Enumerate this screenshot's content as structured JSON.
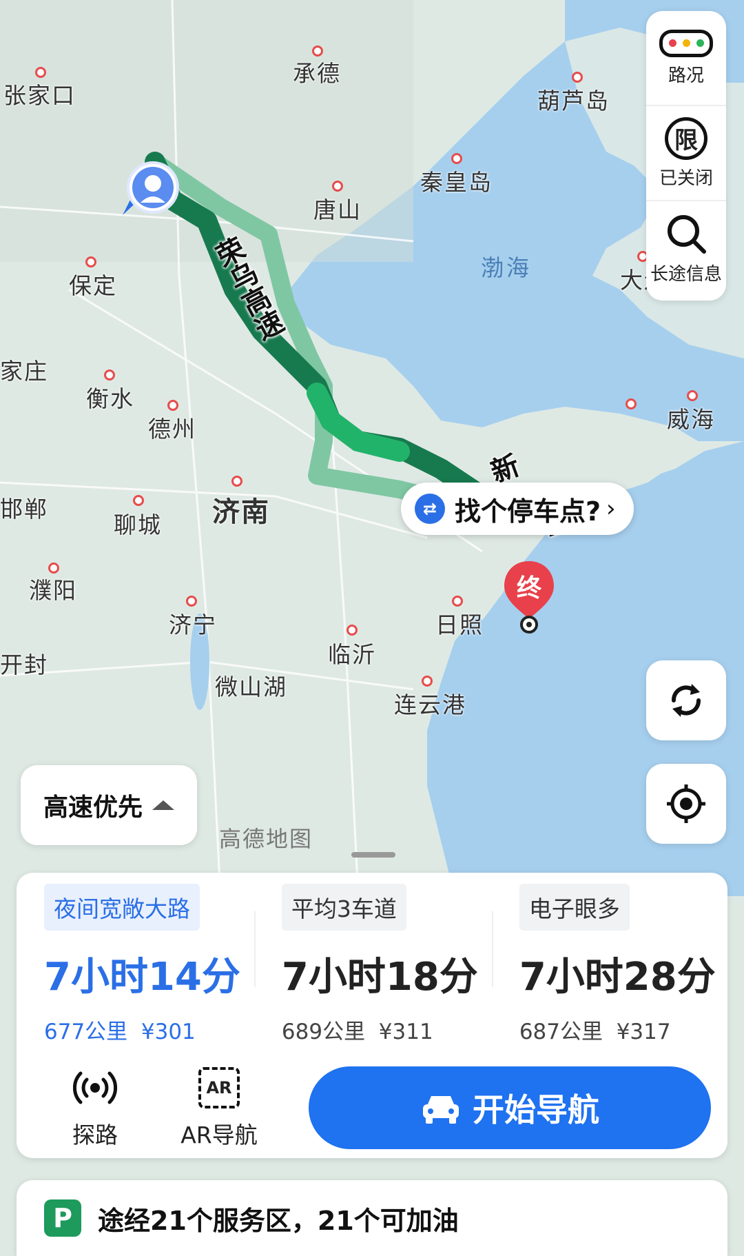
{
  "map": {
    "cities": [
      {
        "name": "张家口"
      },
      {
        "name": "承德"
      },
      {
        "name": "葫芦岛"
      },
      {
        "name": "唐山"
      },
      {
        "name": "秦皇岛"
      },
      {
        "name": "保定"
      },
      {
        "name": "家庄"
      },
      {
        "name": "衡水"
      },
      {
        "name": "德州"
      },
      {
        "name": "济南"
      },
      {
        "name": "邯郸"
      },
      {
        "name": "聊城"
      },
      {
        "name": "濮阳"
      },
      {
        "name": "济宁"
      },
      {
        "name": "临沂"
      },
      {
        "name": "日照"
      },
      {
        "name": "开封"
      },
      {
        "name": "微山湖"
      },
      {
        "name": "连云港"
      },
      {
        "name": "大连"
      },
      {
        "name": "威海"
      }
    ],
    "seas": [
      {
        "name": "渤海"
      }
    ],
    "route_label": "荣乌高速",
    "route_label_2": "新",
    "route_label_3": "区",
    "parking_tip": "找个停车点?",
    "end_marker": "终",
    "watermark": "高德地图",
    "preference": "高速优先"
  },
  "side_panel": {
    "traffic_label": "路况",
    "restrict_label": "已关闭",
    "restrict_glyph": "限",
    "longtrip_label": "长途信息"
  },
  "routes": [
    {
      "tag": "夜间宽敞大路",
      "time": "7小时14分",
      "distance": "677公里",
      "toll": "¥301",
      "active": true
    },
    {
      "tag": "平均3车道",
      "time": "7小时18分",
      "distance": "689公里",
      "toll": "¥311",
      "active": false
    },
    {
      "tag": "电子眼多",
      "time": "7小时28分",
      "distance": "687公里",
      "toll": "¥317",
      "active": false
    }
  ],
  "actions": {
    "explore_label": "探路",
    "ar_label": "AR导航",
    "ar_glyph": "AR",
    "start_label": "开始导航"
  },
  "service": {
    "text": "途经21个服务区，21个可加油",
    "glyph": "P"
  },
  "colors": {
    "primary": "#1f72f0",
    "route_dark": "#177a4f",
    "route_light": "#7fc7a3",
    "sea": "#a6cfee",
    "land": "#dfe9e4",
    "end_red": "#e8414b"
  }
}
